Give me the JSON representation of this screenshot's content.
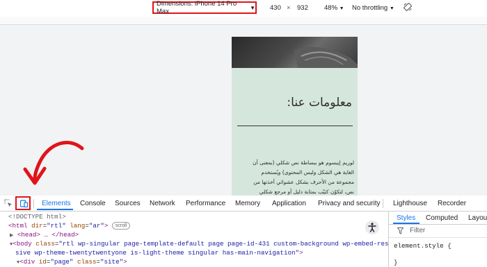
{
  "device_toolbar": {
    "dimensions_label": "Dimensions: iPhone 14 Pro Max",
    "width": "430",
    "times": "×",
    "height": "932",
    "zoom": "48%",
    "throttling": "No throttling"
  },
  "phone_page": {
    "heading": "معلومات عنا:",
    "body_lines": [
      "لوريم إيبسوم هو ببساطة نص شكلي (بمعنى أن",
      "الغاية هي الشكل وليس المحتوى) ويُستخدم",
      "مجموعة من الأحرف بشكل عشوائي أخذتها من",
      "نص، لتكوّن كتيّب بمثابة دليل أو مرجع شكلي"
    ]
  },
  "devtools": {
    "tabs": [
      "Elements",
      "Console",
      "Sources",
      "Network",
      "Performance",
      "Memory",
      "Application",
      "Privacy and security",
      "Lighthouse",
      "Recorder"
    ],
    "dom": {
      "l1": "<!DOCTYPE html>",
      "l2_tag_open": "<html",
      "l2_attr1": "dir",
      "l2_val1": "\"rtl\"",
      "l2_attr2": "lang",
      "l2_val2": "\"ar\"",
      "l2_close": ">",
      "l2_badge": "scroll",
      "l3": "<head> … </head>",
      "l4_tag": "<body",
      "l4_attr": "class",
      "l4_val": "\"rtl wp-singular page-template-default page page-id-431 custom-background wp-embed-respon",
      "l5_val": "sive wp-theme-twentytwentyone is-light-theme singular has-main-navigation\"",
      "l5_close": ">",
      "l6_tag": "<div",
      "l6_attr1": "id",
      "l6_val1": "\"page\"",
      "l6_attr2": "class",
      "l6_val2": "\"site\"",
      "l6_close": ">"
    },
    "styles_tabs": [
      "Styles",
      "Computed",
      "Layout"
    ],
    "filter_placeholder": "Filter",
    "element_style": "element.style {",
    "element_style_close": "}"
  },
  "colors": {
    "highlight": "#e0141b",
    "accent": "#1a73e8",
    "page_bg": "#d5e6dc"
  }
}
